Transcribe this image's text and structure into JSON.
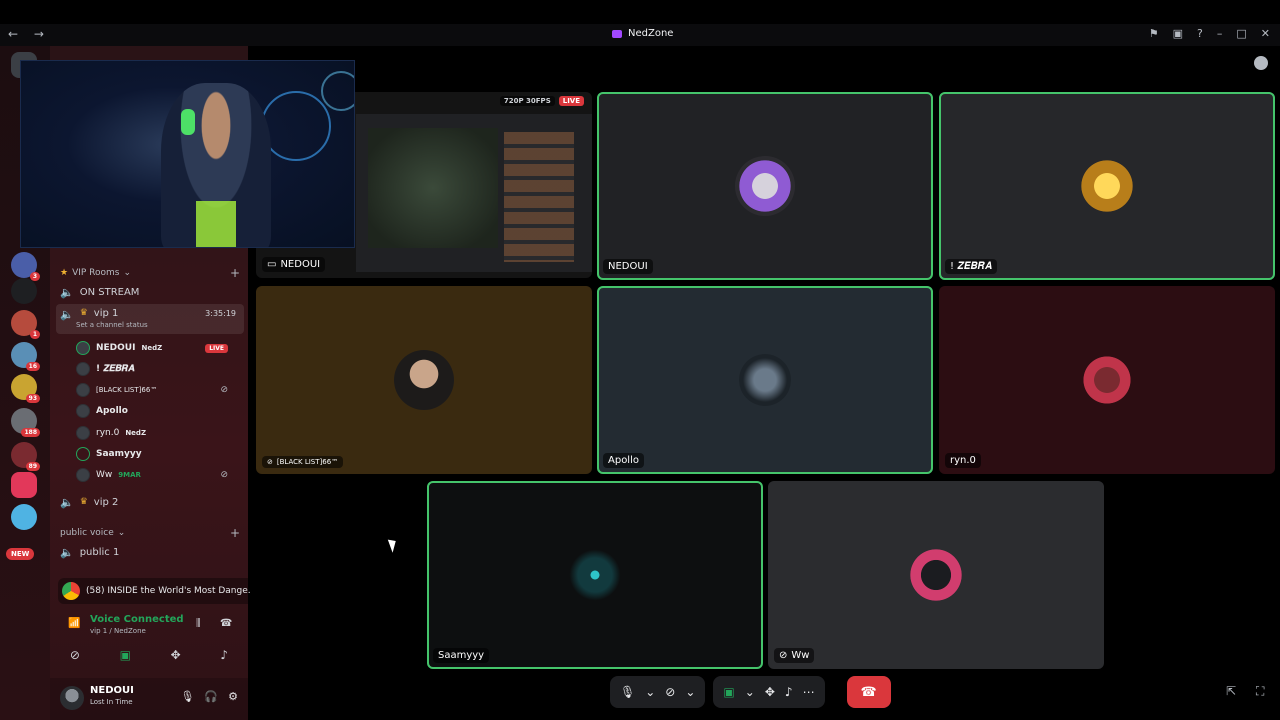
{
  "titlebar": {
    "title": "NedZone",
    "nav_arrows": "← →",
    "icons": [
      "flag-icon",
      "inbox-icon",
      "help-icon",
      "minimize-icon",
      "maximize-icon",
      "close-icon"
    ]
  },
  "servers": [
    {
      "badge": "3"
    },
    {
      "badge": ""
    },
    {
      "badge": "1"
    },
    {
      "badge": "16"
    },
    {
      "badge": "93"
    },
    {
      "badge": "188"
    },
    {
      "badge": "89"
    },
    {
      "badge": ""
    },
    {
      "badge": ""
    }
  ],
  "new_badge": "NEW",
  "sidebar": {
    "category_vip": "VIP Rooms",
    "on_stream": "ON STREAM",
    "vip1": {
      "name": "vip 1",
      "timer": "3:35:19",
      "status": "Set a channel status"
    },
    "members": [
      {
        "name": "NEDOUI",
        "tag": "NedZ",
        "live": "LIVE"
      },
      {
        "name": "! 𝒁𝑬𝑩𝑹𝑨"
      },
      {
        "name": "[BLACK LIST]66™"
      },
      {
        "name": "Apollo"
      },
      {
        "name": "ryn.0",
        "tag": "NedZ"
      },
      {
        "name": "Saamyyy"
      },
      {
        "name": "Ww",
        "tag": "9MAR"
      }
    ],
    "vip2": "vip 2",
    "category_public": "public voice",
    "public1": "public 1"
  },
  "media": {
    "title": "(58) INSIDE the World's Most Dange..."
  },
  "voice": {
    "status": "Voice Connected",
    "channel": "vip 1 / NedZone"
  },
  "user": {
    "name": "NEDOUI",
    "status": "Lost In Time"
  },
  "stage": {
    "stream": {
      "name": "NEDOUI",
      "resolution": "720P 30FPS",
      "live": "LIVE"
    },
    "tiles": {
      "nedoui": "NEDOUI",
      "zebra": "! 𝒁𝑬𝑩𝑹𝑨",
      "blacklist": "[BLACK LIST]66™",
      "apollo": "Apollo",
      "ryn": "ryn.0",
      "saamyyy": "Saamyyy",
      "ww": "Ww"
    }
  },
  "colors": {
    "speaking": "#45c46b",
    "live": "#da373c",
    "voice_green": "#23a55a"
  }
}
